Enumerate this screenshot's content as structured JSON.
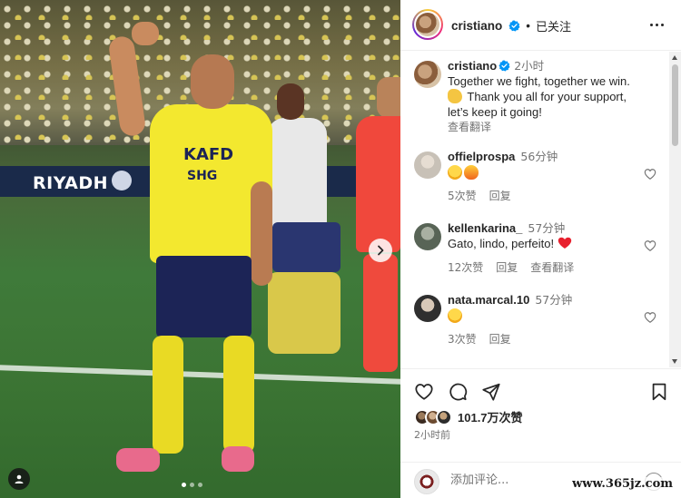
{
  "post": {
    "author": "cristiano",
    "follow_state": "已关注",
    "separator": "•",
    "caption_line1": "Together we fight, together we win.",
    "caption_line2": "Thank you all for your support, let’s keep it going!",
    "caption_time": "2小时",
    "translate_label": "查看翻译",
    "likes": "101.7万次赞",
    "posted_ago": "2小时前",
    "comment_placeholder": "添加评论...",
    "photo_banner_text": "RIYADH",
    "jersey_text_1": "KAFD",
    "jersey_text_2": "SHG"
  },
  "comments": [
    {
      "user": "offielprospa",
      "time": "56分钟",
      "emojis": [
        "heart-eyes",
        "fire"
      ],
      "likes": "5次赞",
      "reply": "回复",
      "translate": ""
    },
    {
      "user": "kellenkarina_",
      "time": "57分钟",
      "text": "Gato, lindo, perfeito!",
      "emojis": [
        "red-heart"
      ],
      "likes": "12次赞",
      "reply": "回复",
      "translate": "查看翻译"
    },
    {
      "user": "nata.marcal.10",
      "time": "57分钟",
      "emojis": [
        "heart-eyes"
      ],
      "likes": "3次赞",
      "reply": "回复",
      "translate": ""
    }
  ],
  "carousel": {
    "total": 3,
    "active": 0
  },
  "icons": {
    "verified": "verified-badge-icon",
    "more": "more-options-icon",
    "like": "heart-icon",
    "comment": "comment-icon",
    "share": "share-icon",
    "save": "bookmark-icon",
    "next": "chevron-right-icon",
    "tag": "user-tag-icon",
    "emoji": "emoji-icon"
  },
  "colors": {
    "verified": "#0095f6",
    "text": "#262626",
    "muted": "#737373",
    "heart": "#ed4956",
    "jersey": "#f3e82f"
  },
  "watermark": "www.365jz.com"
}
